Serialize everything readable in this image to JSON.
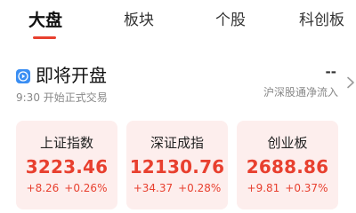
{
  "tabs": {
    "items": [
      {
        "label": "大盘",
        "active": true
      },
      {
        "label": "板块",
        "active": false
      },
      {
        "label": "个股",
        "active": false
      },
      {
        "label": "科创板",
        "active": false
      }
    ]
  },
  "section": {
    "icon": "play-icon",
    "title": "即将开盘",
    "subtitle": "9:30 开始正式交易",
    "flow_value": "--",
    "flow_label": "沪深股通净流入"
  },
  "indices": [
    {
      "name": "上证指数",
      "value": "3223.46",
      "change": "+8.26",
      "change_pct": "+0.26%"
    },
    {
      "name": "深证成指",
      "value": "12130.76",
      "change": "+34.37",
      "change_pct": "+0.28%"
    },
    {
      "name": "创业板",
      "value": "2688.86",
      "change": "+9.81",
      "change_pct": "+0.37%"
    }
  ],
  "colors": {
    "accent": "#e8402f",
    "card_bg": "#fdeeed",
    "icon_blue": "#3a8ef3"
  }
}
